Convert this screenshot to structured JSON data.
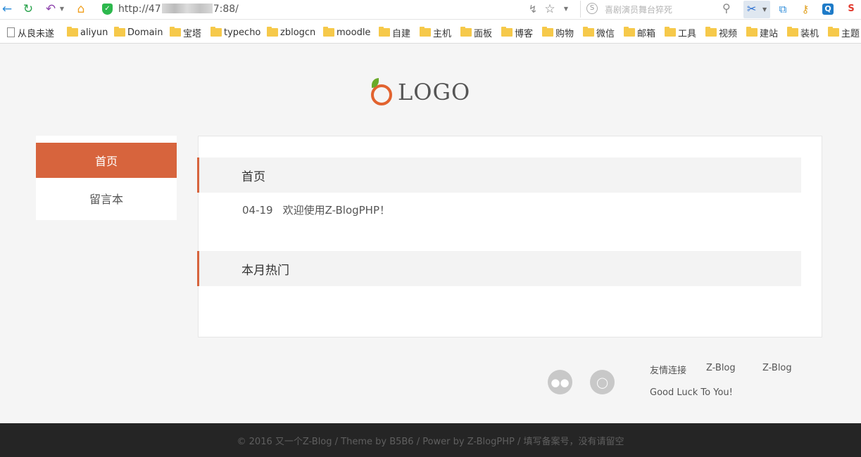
{
  "browser": {
    "url_prefix": "http://47",
    "url_suffix": "7:88/",
    "search_placeholder": "喜剧演员舞台猝死",
    "icons": {
      "back": "back-arrow-icon",
      "refresh": "refresh-icon",
      "undo": "undo-icon",
      "home": "home-icon",
      "secure": "shield-check-icon",
      "speed": "lightning-icon",
      "bookmark": "star-icon",
      "search": "magnifier-icon",
      "cut": "scissors-icon"
    },
    "accent": "#2db84d"
  },
  "bookmarks": [
    {
      "label": "从良未遂",
      "type": "page"
    },
    {
      "label": "aliyun",
      "type": "folder"
    },
    {
      "label": "Domain",
      "type": "folder"
    },
    {
      "label": "宝塔",
      "type": "folder"
    },
    {
      "label": "typecho",
      "type": "folder"
    },
    {
      "label": "zblogcn",
      "type": "folder"
    },
    {
      "label": "moodle",
      "type": "folder"
    },
    {
      "label": "自建",
      "type": "folder"
    },
    {
      "label": "主机",
      "type": "folder"
    },
    {
      "label": "面板",
      "type": "folder"
    },
    {
      "label": "博客",
      "type": "folder"
    },
    {
      "label": "购物",
      "type": "folder"
    },
    {
      "label": "微信",
      "type": "folder"
    },
    {
      "label": "邮箱",
      "type": "folder"
    },
    {
      "label": "工具",
      "type": "folder"
    },
    {
      "label": "视频",
      "type": "folder"
    },
    {
      "label": "建站",
      "type": "folder"
    },
    {
      "label": "装机",
      "type": "folder"
    },
    {
      "label": "主题",
      "type": "folder"
    }
  ],
  "site": {
    "logo_text": "LOGO",
    "accent_color": "#d7643d",
    "nav": [
      {
        "label": "首页",
        "active": true
      },
      {
        "label": "留言本",
        "active": false
      }
    ],
    "sections": {
      "home_title": "首页",
      "hot_title": "本月热门"
    },
    "posts": [
      {
        "date": "04-19",
        "title": "欢迎使用Z-BlogPHP！"
      }
    ],
    "social": [
      "wechat-icon",
      "weibo-icon"
    ],
    "friend_links": {
      "title": "友情连接",
      "items": [
        "Z-Blog",
        "Z-Blog"
      ]
    },
    "tagline": "Good Luck To You!",
    "footer": "© 2016 又一个Z-Blog / Theme by B5B6 / Power by Z-BlogPHP / 填写备案号，没有请留空"
  }
}
